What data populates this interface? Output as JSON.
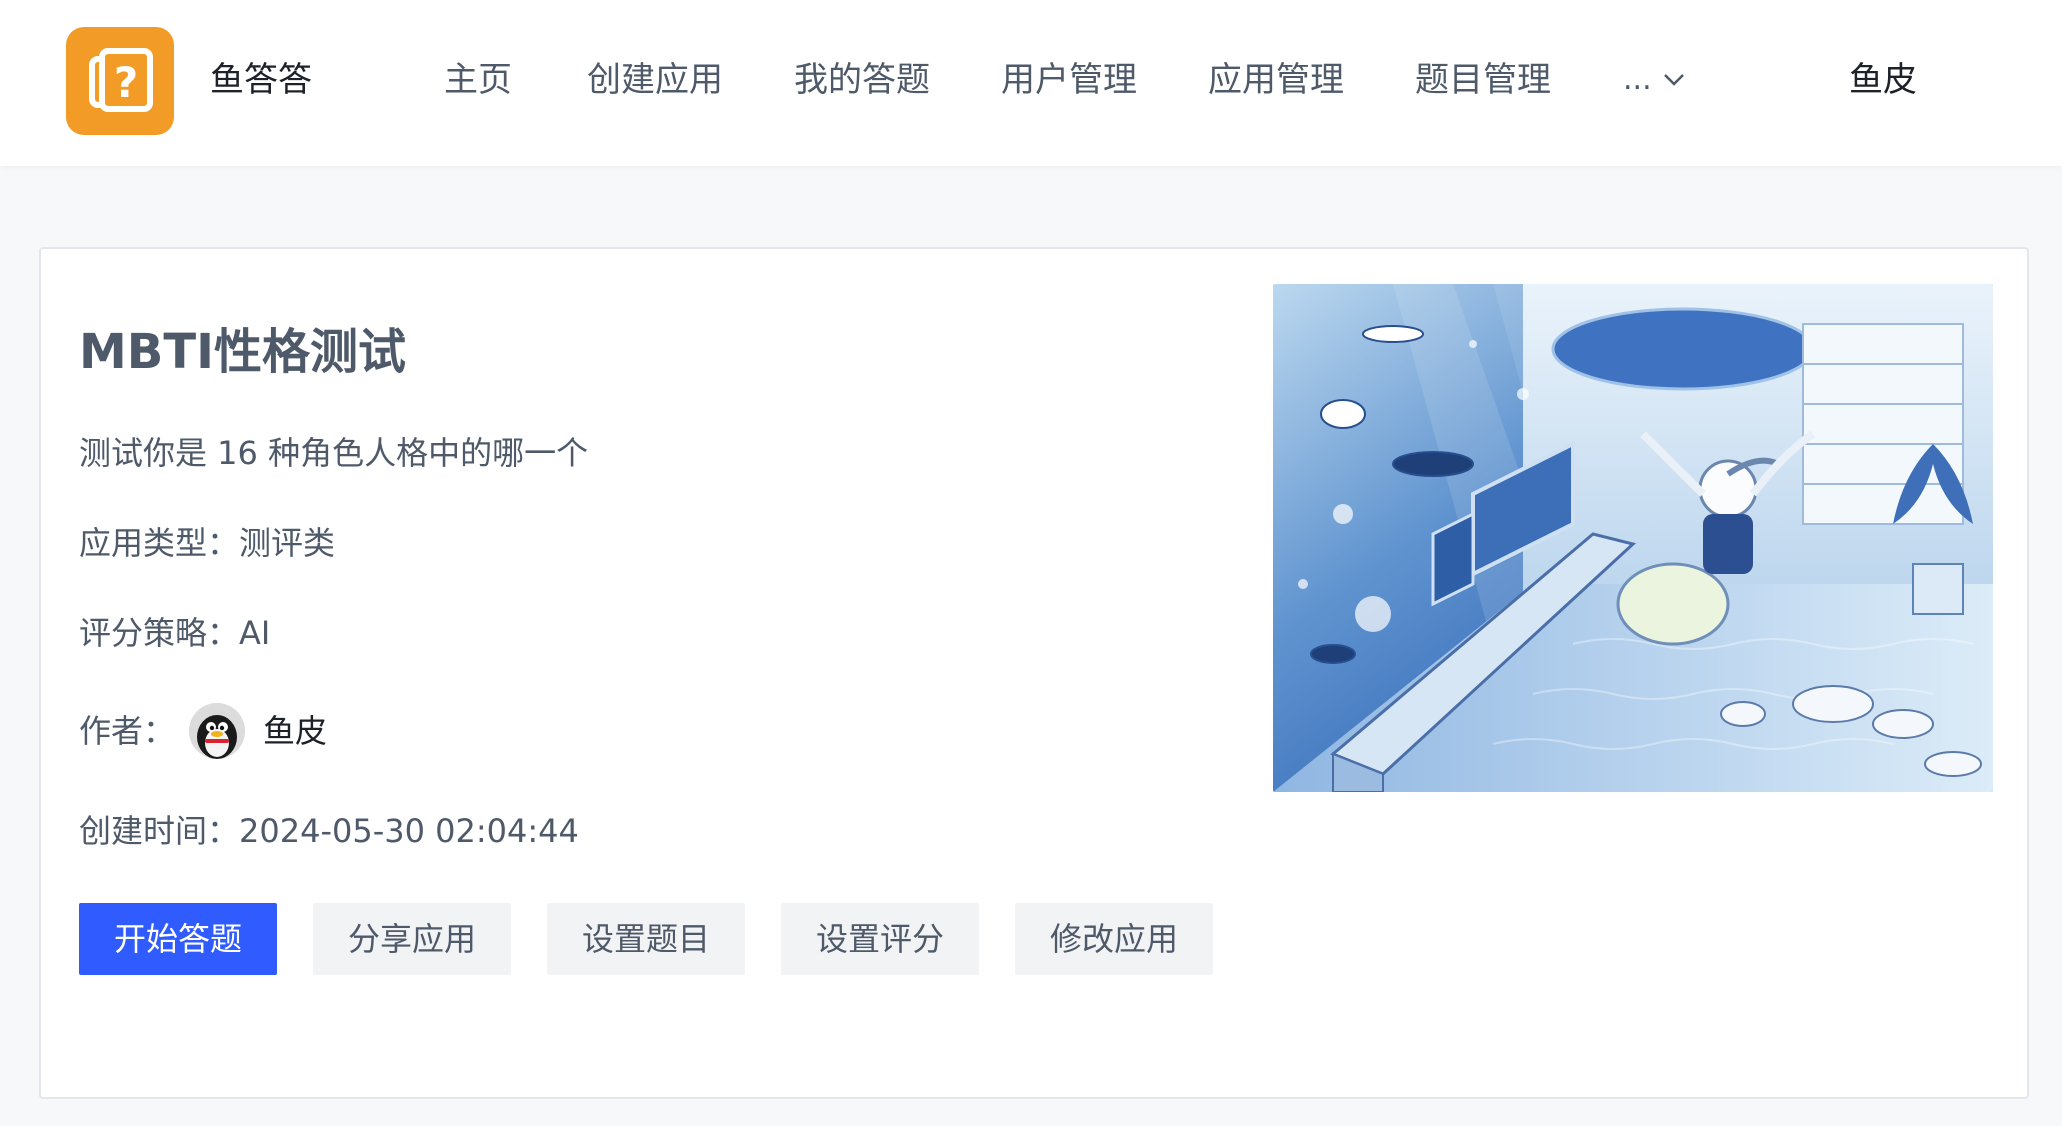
{
  "header": {
    "brand": "鱼答答",
    "nav": [
      "主页",
      "创建应用",
      "我的答题",
      "用户管理",
      "应用管理",
      "题目管理"
    ],
    "more": "...",
    "user": "鱼皮"
  },
  "app": {
    "title": "MBTI性格测试",
    "description": "测试你是 16 种角色人格中的哪一个",
    "type_label": "应用类型：",
    "type_value": "测评类",
    "scoring_label": "评分策略：",
    "scoring_value": "AI",
    "author_label": "作者：",
    "author_name": "鱼皮",
    "created_label": "创建时间：",
    "created_value": "2024-05-30 02:04:44"
  },
  "actions": {
    "start": "开始答题",
    "share": "分享应用",
    "set_questions": "设置题目",
    "set_scoring": "设置评分",
    "edit": "修改应用"
  },
  "colors": {
    "brand_orange": "#f29b26",
    "primary_blue": "#2f5bff",
    "text_secondary": "#4e5969"
  },
  "icons": {
    "logo": "question-mark-card-icon",
    "more": "chevron-down-icon"
  }
}
